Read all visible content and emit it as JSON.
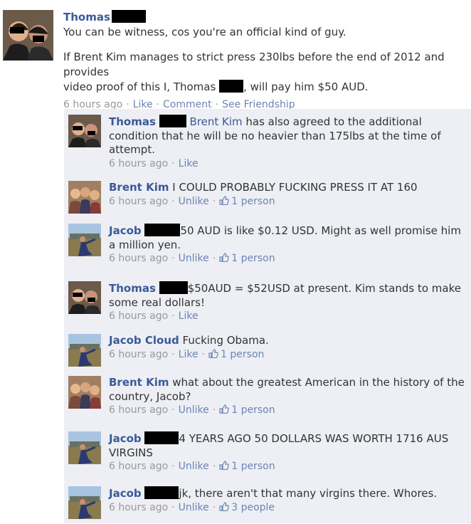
{
  "post": {
    "author": "Thomas",
    "line1": "You can be witness, cos you're an official kind of guy.",
    "line2a": "If Brent Kim manages to strict press 230lbs before the end of 2012 and provides",
    "line2b_pre": "video proof of this I, Thomas",
    "line2b_post": ", will pay him $50 AUD.",
    "time": "6 hours ago",
    "actions": [
      "Like",
      "Comment",
      "See Friendship"
    ]
  },
  "comments": [
    {
      "author": "Thomas",
      "mention": "Brent Kim",
      "text": " has also agreed to the additional condition that he will be no heavier than 175lbs at the time of attempt.",
      "time": "6 hours ago",
      "action": "Like",
      "likes": ""
    },
    {
      "author": "Brent Kim",
      "text": "I COULD PROBABLY FUCKING PRESS IT AT 160",
      "time": "6 hours ago",
      "action": "Unlike",
      "likes": "1 person"
    },
    {
      "author": "Jacob",
      "text": "50 AUD is like $0.12 USD. Might as well promise him a million yen.",
      "time": "6 hours ago",
      "action": "Unlike",
      "likes": "1 person"
    },
    {
      "author": "Thomas",
      "text": "$50AUD = $52USD at present. Kim stands to make some real dollars!",
      "time": "6 hours ago",
      "action": "Like",
      "likes": ""
    },
    {
      "author": "Jacob Cloud",
      "text": "Fucking Obama.",
      "time": "6 hours ago",
      "action": "Like",
      "likes": "1 person"
    },
    {
      "author": "Brent Kim",
      "text": "what about the greatest American in the history of the country, Jacob?",
      "time": "6 hours ago",
      "action": "Unlike",
      "likes": "1 person"
    },
    {
      "author": "Jacob",
      "text": "4 YEARS AGO 50 DOLLARS WAS WORTH 1716 AUS VIRGINS",
      "time": "6 hours ago",
      "action": "Unlike",
      "likes": "1 person"
    },
    {
      "author": "Jacob",
      "text": "jk, there aren't that many virgins there. Whores.",
      "time": "6 hours ago",
      "action": "Unlike",
      "likes": "3 people"
    }
  ],
  "colors": {
    "link": "#3b5998",
    "comment_bg": "#edeff4",
    "meta": "#999999"
  },
  "icons": {
    "like": "thumbs-up-icon"
  }
}
